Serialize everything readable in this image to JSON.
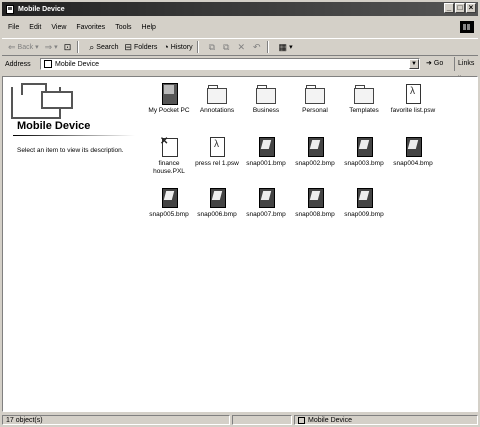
{
  "window": {
    "title": "Mobile Device"
  },
  "menu": [
    "File",
    "Edit",
    "View",
    "Favorites",
    "Tools",
    "Help"
  ],
  "toolbar": {
    "back": "Back",
    "search": "Search",
    "folders": "Folders",
    "history": "History"
  },
  "address": {
    "label": "Address",
    "value": "Mobile Device",
    "go": "Go",
    "links": "Links"
  },
  "left_pane": {
    "title": "Mobile Device",
    "description": "Select an item to view its description."
  },
  "items": [
    {
      "label": "My Pocket PC",
      "kind": "pc",
      "icon": "pocket-pc-icon"
    },
    {
      "label": "Annotations",
      "kind": "folder",
      "icon": "folder-icon"
    },
    {
      "label": "Business",
      "kind": "folder",
      "icon": "folder-icon"
    },
    {
      "label": "Personal",
      "kind": "folder",
      "icon": "folder-icon"
    },
    {
      "label": "Templates",
      "kind": "folder",
      "icon": "folder-icon"
    },
    {
      "label": "favorite list.psw",
      "kind": "doc",
      "icon": "document-icon"
    },
    {
      "label": "finance house.PXL",
      "kind": "pxl",
      "icon": "spreadsheet-icon"
    },
    {
      "label": "press rel 1.psw",
      "kind": "doc",
      "icon": "document-icon"
    },
    {
      "label": "snap001.bmp",
      "kind": "bmp",
      "icon": "bitmap-icon"
    },
    {
      "label": "snap002.bmp",
      "kind": "bmp",
      "icon": "bitmap-icon"
    },
    {
      "label": "snap003.bmp",
      "kind": "bmp",
      "icon": "bitmap-icon"
    },
    {
      "label": "snap004.bmp",
      "kind": "bmp",
      "icon": "bitmap-icon"
    },
    {
      "label": "snap005.bmp",
      "kind": "bmp",
      "icon": "bitmap-icon"
    },
    {
      "label": "snap006.bmp",
      "kind": "bmp",
      "icon": "bitmap-icon"
    },
    {
      "label": "snap007.bmp",
      "kind": "bmp",
      "icon": "bitmap-icon"
    },
    {
      "label": "snap008.bmp",
      "kind": "bmp",
      "icon": "bitmap-icon"
    },
    {
      "label": "snap009.bmp",
      "kind": "bmp",
      "icon": "bitmap-icon"
    }
  ],
  "status": {
    "count": "17 object(s)",
    "location": "Mobile Device"
  }
}
